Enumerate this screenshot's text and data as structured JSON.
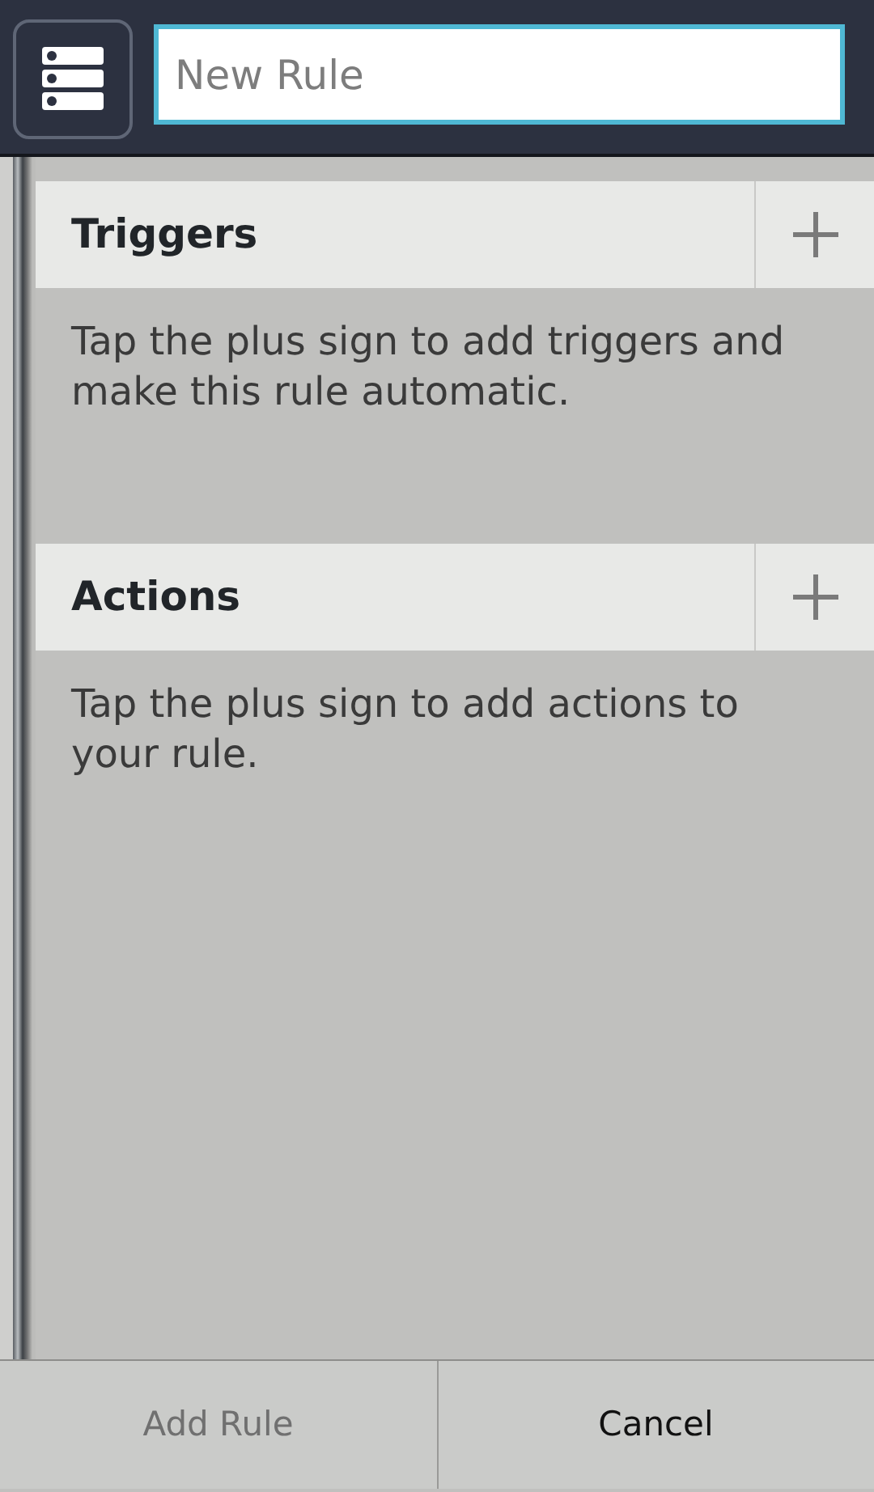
{
  "rule_name": {
    "placeholder": "New Rule"
  },
  "sections": [
    {
      "title": "Triggers",
      "hint": "Tap the plus sign to add triggers and make this rule automatic."
    },
    {
      "title": "Actions",
      "hint": "Tap the plus sign to add actions to your rule."
    }
  ],
  "buttons": [
    {
      "label": "Add Rule",
      "disabled": true
    },
    {
      "label": "Cancel",
      "disabled": false
    }
  ]
}
